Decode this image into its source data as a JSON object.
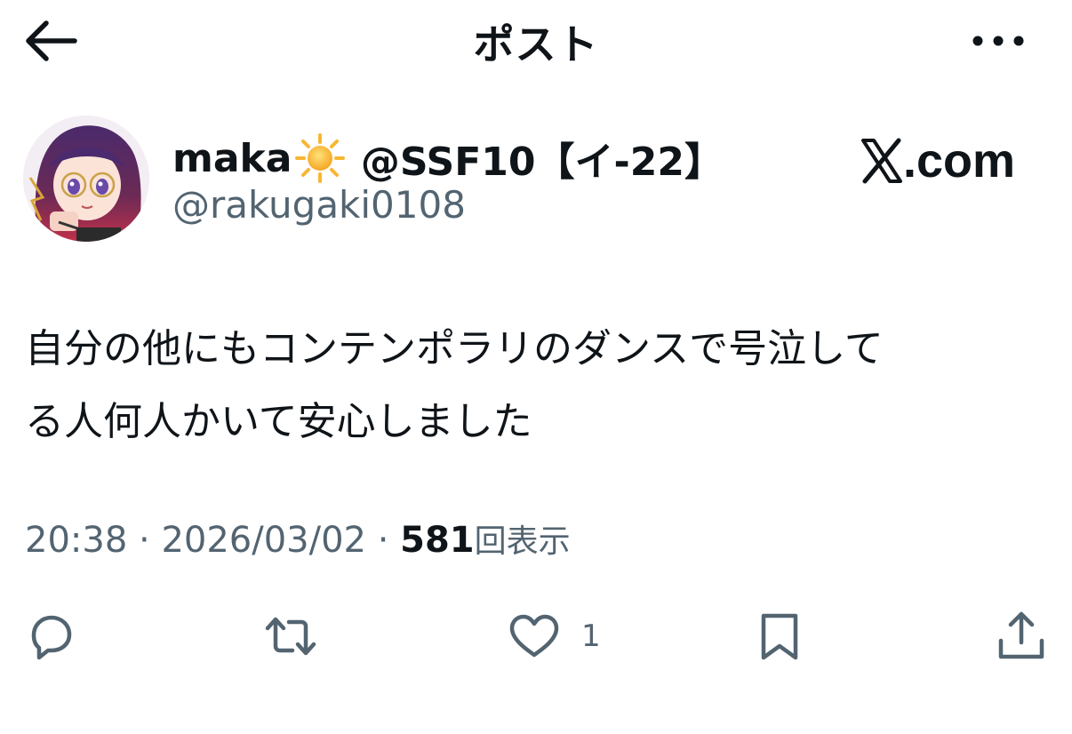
{
  "header": {
    "title": "ポスト",
    "back_icon": "arrow-left-icon",
    "more_icon": "more-horizontal-icon"
  },
  "author": {
    "display_name_prefix": "maka",
    "display_name_emoji": "sun-emoji",
    "display_name_suffix": " @SSF10【イ-22】",
    "handle": "@rakugaki0108",
    "avatar": "avatar-illustration"
  },
  "watermark": {
    "logo": "x-logo-icon",
    "text": ".com"
  },
  "post": {
    "text": "自分の他にもコンテンポラリのダンスで号泣して\nる人何人かいて安心しました"
  },
  "meta": {
    "time": "20:38",
    "separator": "·",
    "date": "2026/03/02",
    "views_count": "581",
    "views_label": "回表示"
  },
  "actions": {
    "reply_icon": "reply-icon",
    "repost_icon": "repost-icon",
    "like_icon": "heart-icon",
    "like_count": "1",
    "bookmark_icon": "bookmark-icon",
    "share_icon": "share-icon"
  },
  "colors": {
    "text_primary": "#0f1419",
    "text_secondary": "#536471",
    "icon": "#536471",
    "background": "#ffffff"
  }
}
